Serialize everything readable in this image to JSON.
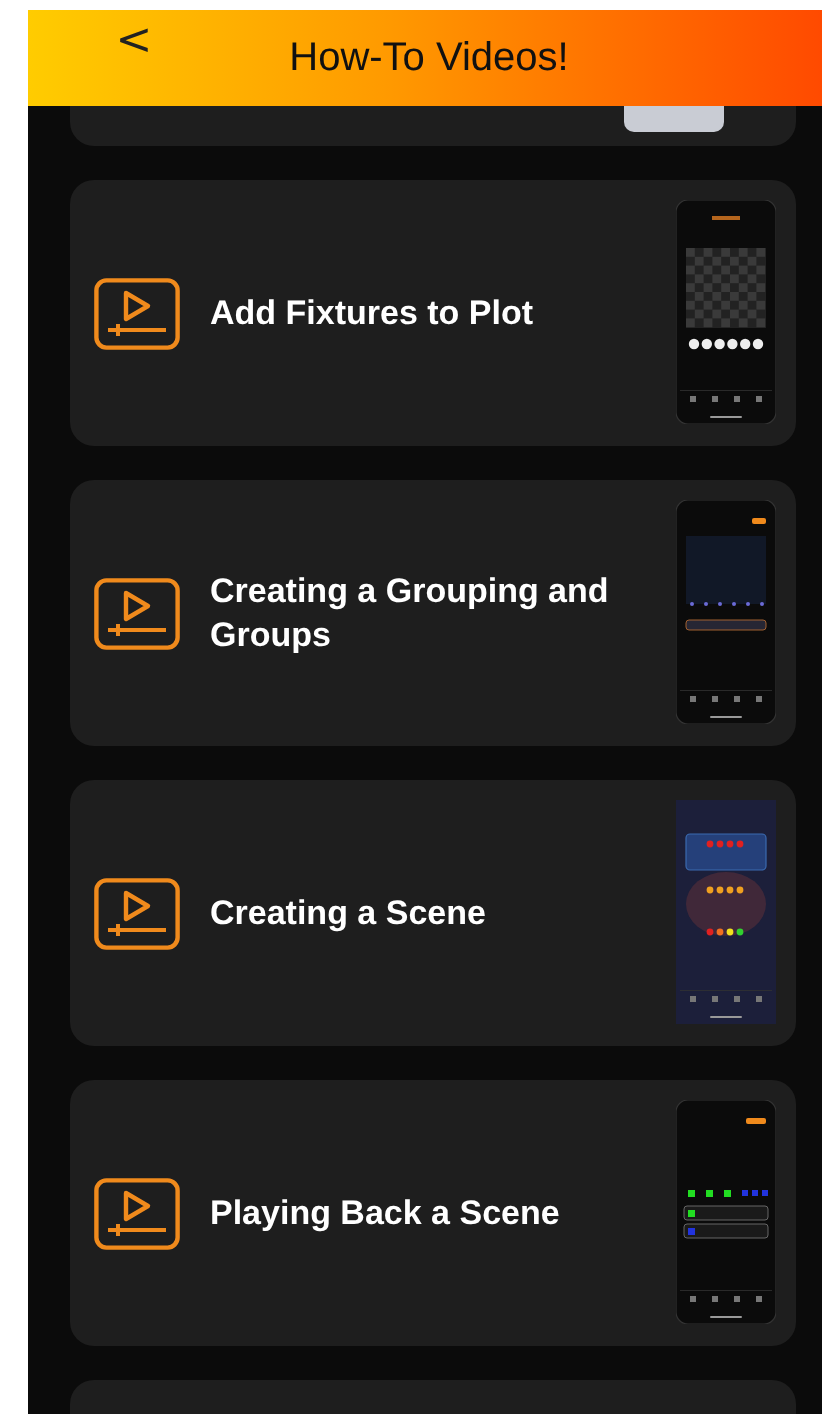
{
  "header": {
    "back": "<",
    "title": "How-To Videos!"
  },
  "videos": [
    {
      "title": "Add Fixtures to Plot",
      "kind": "plot"
    },
    {
      "title": "Creating a Grouping and Groups",
      "kind": "groups"
    },
    {
      "title": "Creating a Scene",
      "kind": "effects"
    },
    {
      "title": "Playing Back a Scene",
      "kind": "playback"
    }
  ]
}
